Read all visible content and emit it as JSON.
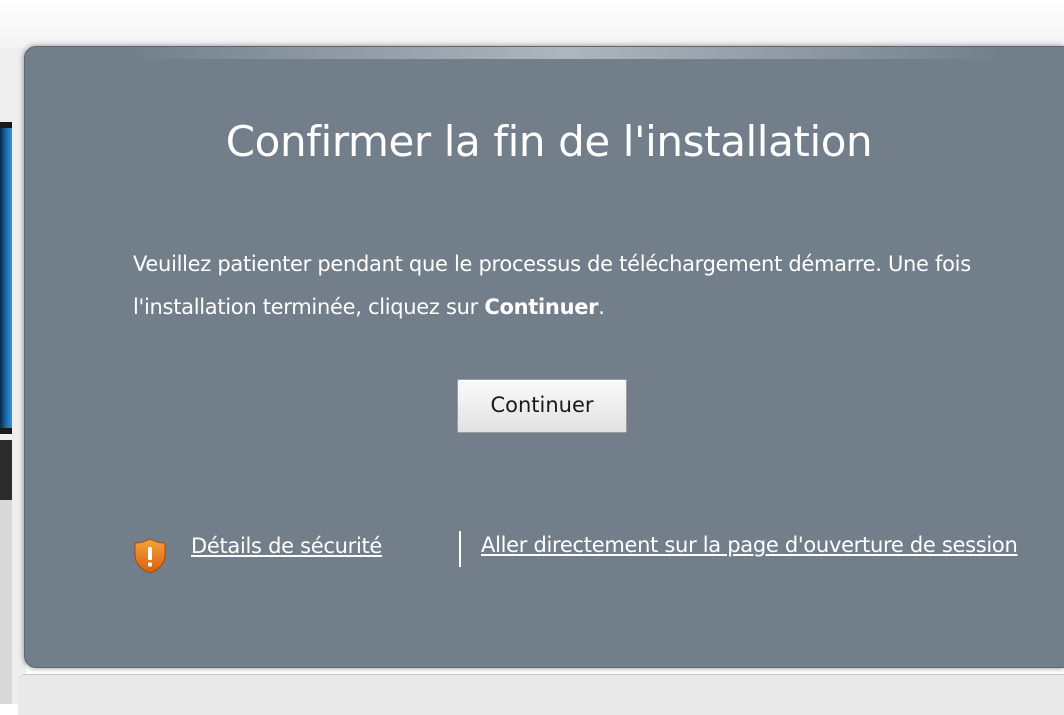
{
  "dialog": {
    "title": "Confirmer la fin de l'installation",
    "message_part1": "Veuillez patienter pendant que le processus de téléchargement démarre. Une fois l'installation terminée, cliquez sur ",
    "message_bold": "Continuer",
    "message_part2": ".",
    "continue_label": "Continuer",
    "security_link": "Détails de sécurité",
    "session_link": "Aller directement sur la page d'ouverture de session"
  },
  "icons": {
    "security": "shield-warning-icon"
  },
  "colors": {
    "dialog_background": "#727f8b",
    "text": "#ffffff",
    "shield_orange": "#e8741a"
  }
}
